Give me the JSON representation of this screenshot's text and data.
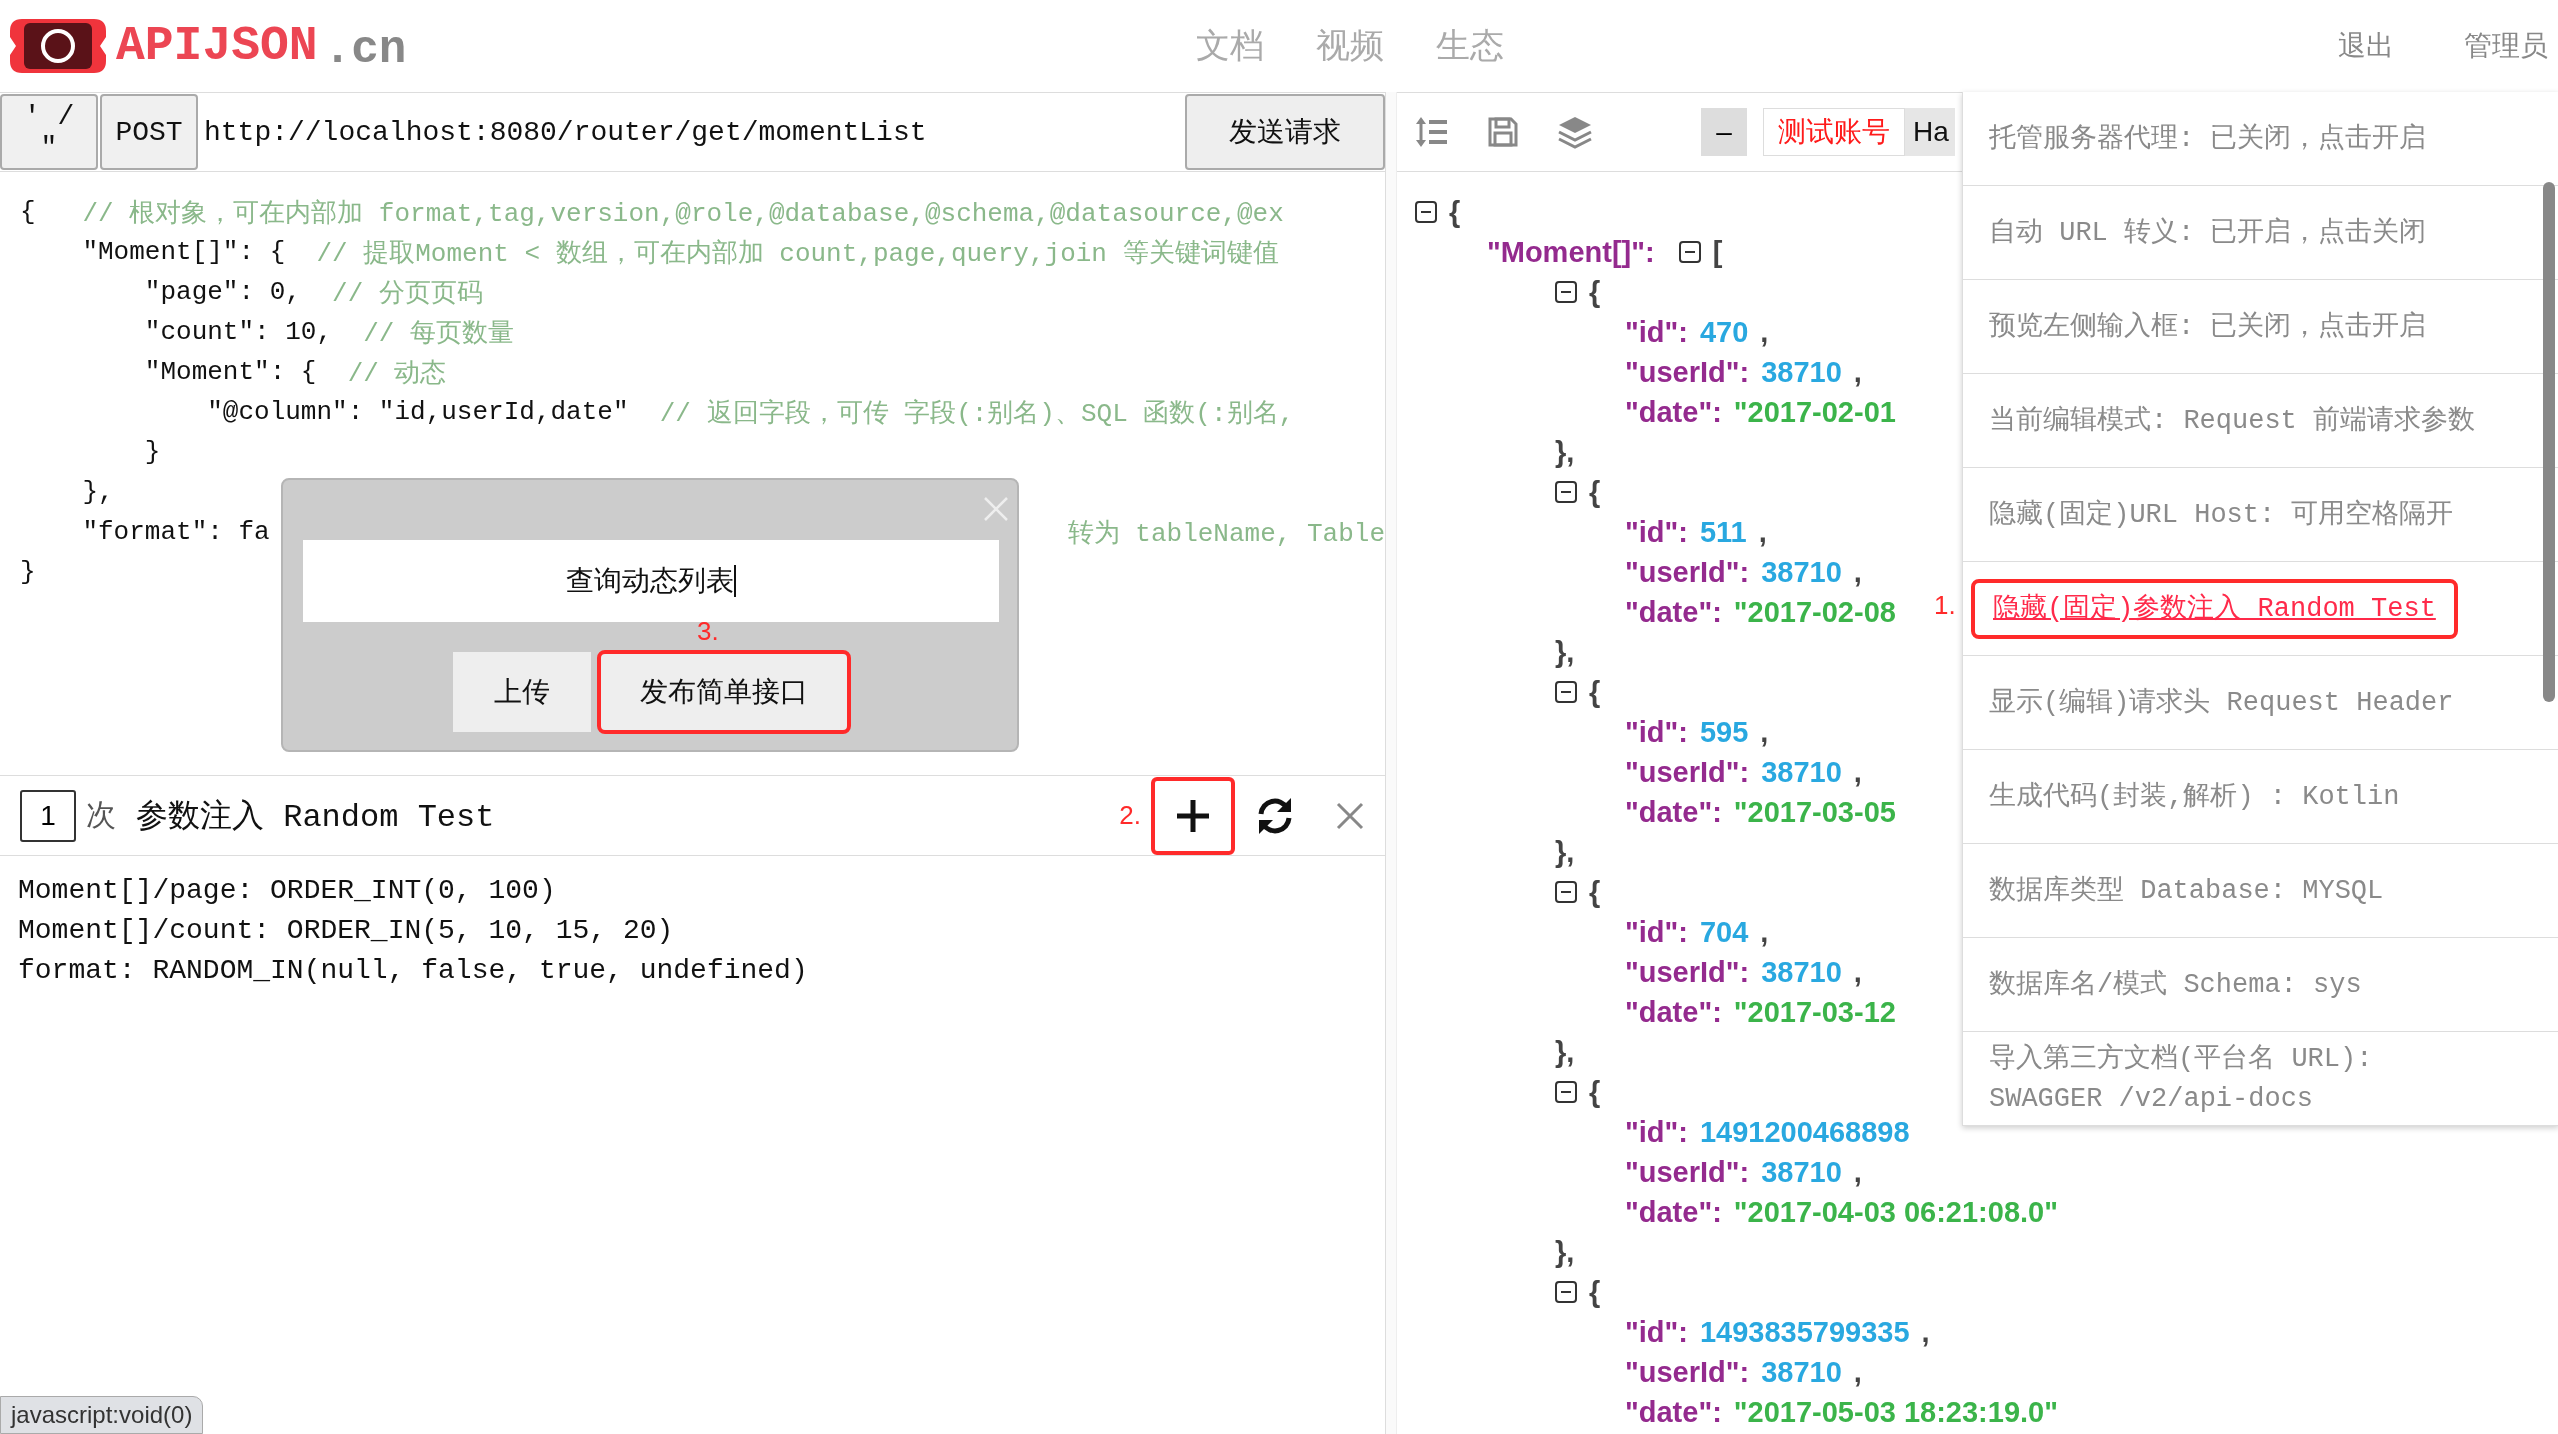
{
  "header": {
    "logo_text": "APIJSON",
    "logo_suffix": ".cn",
    "nav": [
      "文档",
      "视频",
      "生态"
    ],
    "user_links": [
      "退出",
      "管理员"
    ]
  },
  "request": {
    "quote_button": "' / \"",
    "method": "POST",
    "url": "http://localhost:8080/router/get/momentList",
    "send_button": "发送请求"
  },
  "editor": {
    "lines": [
      {
        "kind": "plain",
        "code": "{   ",
        "comment": "// 根对象，可在内部加 format,tag,version,@role,@database,@schema,@datasource,@ex"
      },
      {
        "kind": "plain",
        "code": "    \"Moment[]\": {  ",
        "comment": "// 提取Moment < 数组，可在内部加 count,page,query,join 等关键词键值"
      },
      {
        "kind": "plain",
        "code": "        \"page\": 0,  ",
        "comment": "// 分页页码"
      },
      {
        "kind": "plain",
        "code": "        \"count\": 10,  ",
        "comment": "// 每页数量"
      },
      {
        "kind": "plain",
        "code": "        \"Moment\": {  ",
        "comment": "// 动态"
      },
      {
        "kind": "plain",
        "code": "            \"@column\": \"id,userId,date\"  ",
        "comment": "// 返回字段，可传 字段(:别名)、SQL 函数(:别名,"
      },
      {
        "kind": "plain",
        "code": "        }"
      },
      {
        "kind": "plain",
        "code": "    },"
      },
      {
        "kind": "covered",
        "code": "    \"format\": fa",
        "comment": "转为 tableName, Table"
      },
      {
        "kind": "plain",
        "code": "}"
      }
    ]
  },
  "dialog": {
    "value": "查询动态列表",
    "annotation": "3.",
    "buttons": [
      {
        "label": "上传",
        "marked": false
      },
      {
        "label": "发布简单接口",
        "marked": true
      }
    ]
  },
  "random_test": {
    "count": "1",
    "count_unit": "次",
    "title": "参数注入 Random Test",
    "add_annotation": "2.",
    "add_marked": true,
    "config_lines": [
      "Moment[]/page: ORDER_INT(0, 100)",
      "Moment[]/count: ORDER_IN(5, 10, 15, 20)",
      "format: RANDOM_IN(null, false, true, undefined)"
    ]
  },
  "toolbar": {
    "collapse_button": "–",
    "account": "测试账号",
    "account_next": "Ha"
  },
  "response": {
    "open": "{",
    "members": [
      {
        "key": "\"Moment[]\":",
        "open": "[",
        "items": [
          {
            "open": "{",
            "close": "},",
            "fields": [
              {
                "key": "\"id\":",
                "value": "470",
                "kind": "number",
                "tail": ","
              },
              {
                "key": "\"userId\":",
                "value": "38710",
                "kind": "number",
                "tail": ","
              },
              {
                "key": "\"date\":",
                "value": "\"2017-02-01",
                "kind": "string"
              }
            ]
          },
          {
            "open": "{",
            "close": "},",
            "fields": [
              {
                "key": "\"id\":",
                "value": "511",
                "kind": "number",
                "tail": ","
              },
              {
                "key": "\"userId\":",
                "value": "38710",
                "kind": "number",
                "tail": ","
              },
              {
                "key": "\"date\":",
                "value": "\"2017-02-08",
                "kind": "string"
              }
            ]
          },
          {
            "open": "{",
            "close": "},",
            "fields": [
              {
                "key": "\"id\":",
                "value": "595",
                "kind": "number",
                "tail": ","
              },
              {
                "key": "\"userId\":",
                "value": "38710",
                "kind": "number",
                "tail": ","
              },
              {
                "key": "\"date\":",
                "value": "\"2017-03-05",
                "kind": "string"
              }
            ]
          },
          {
            "open": "{",
            "close": "},",
            "fields": [
              {
                "key": "\"id\":",
                "value": "704",
                "kind": "number",
                "tail": ","
              },
              {
                "key": "\"userId\":",
                "value": "38710",
                "kind": "number",
                "tail": ","
              },
              {
                "key": "\"date\":",
                "value": "\"2017-03-12",
                "kind": "string"
              }
            ]
          },
          {
            "open": "{",
            "close": "},",
            "fields": [
              {
                "key": "\"id\":",
                "value": "1491200468898",
                "kind": "number"
              },
              {
                "key": "\"userId\":",
                "value": "38710",
                "kind": "number",
                "tail": ","
              },
              {
                "key": "\"date\":",
                "value": "\"2017-04-03 06:21:08.0\"",
                "kind": "string"
              }
            ]
          },
          {
            "open": "{",
            "fields": [
              {
                "key": "\"id\":",
                "value": "1493835799335",
                "kind": "number",
                "tail": ","
              },
              {
                "key": "\"userId\":",
                "value": "38710",
                "kind": "number",
                "tail": ","
              },
              {
                "key": "\"date\":",
                "value": "\"2017-05-03 18:23:19.0\"",
                "kind": "string"
              }
            ]
          }
        ]
      }
    ]
  },
  "menu": {
    "items": [
      {
        "label": "托管服务器代理: 已关闭，点击开启",
        "highlighted": false
      },
      {
        "label": "自动 URL 转义: 已开启，点击关闭",
        "highlighted": false
      },
      {
        "label": "预览左侧输入框: 已关闭，点击开启",
        "highlighted": false
      },
      {
        "label": "当前编辑模式: Request 前端请求参数",
        "highlighted": false
      },
      {
        "label": "隐藏(固定)URL Host: 可用空格隔开",
        "highlighted": false
      },
      {
        "label": "隐藏(固定)参数注入 Random Test",
        "highlighted": true,
        "annotation": "1."
      },
      {
        "label": "显示(编辑)请求头 Request Header",
        "highlighted": false
      },
      {
        "label": "生成代码(封装,解析) : Kotlin",
        "highlighted": false
      },
      {
        "label": "数据库类型 Database: MYSQL",
        "highlighted": false
      },
      {
        "label": "数据库名/模式 Schema: sys",
        "highlighted": false
      },
      {
        "label": "导入第三方文档(平台名 URL):\nSWAGGER /v2/api-docs",
        "highlighted": false
      }
    ]
  },
  "status_url": "javascript:void(0)"
}
